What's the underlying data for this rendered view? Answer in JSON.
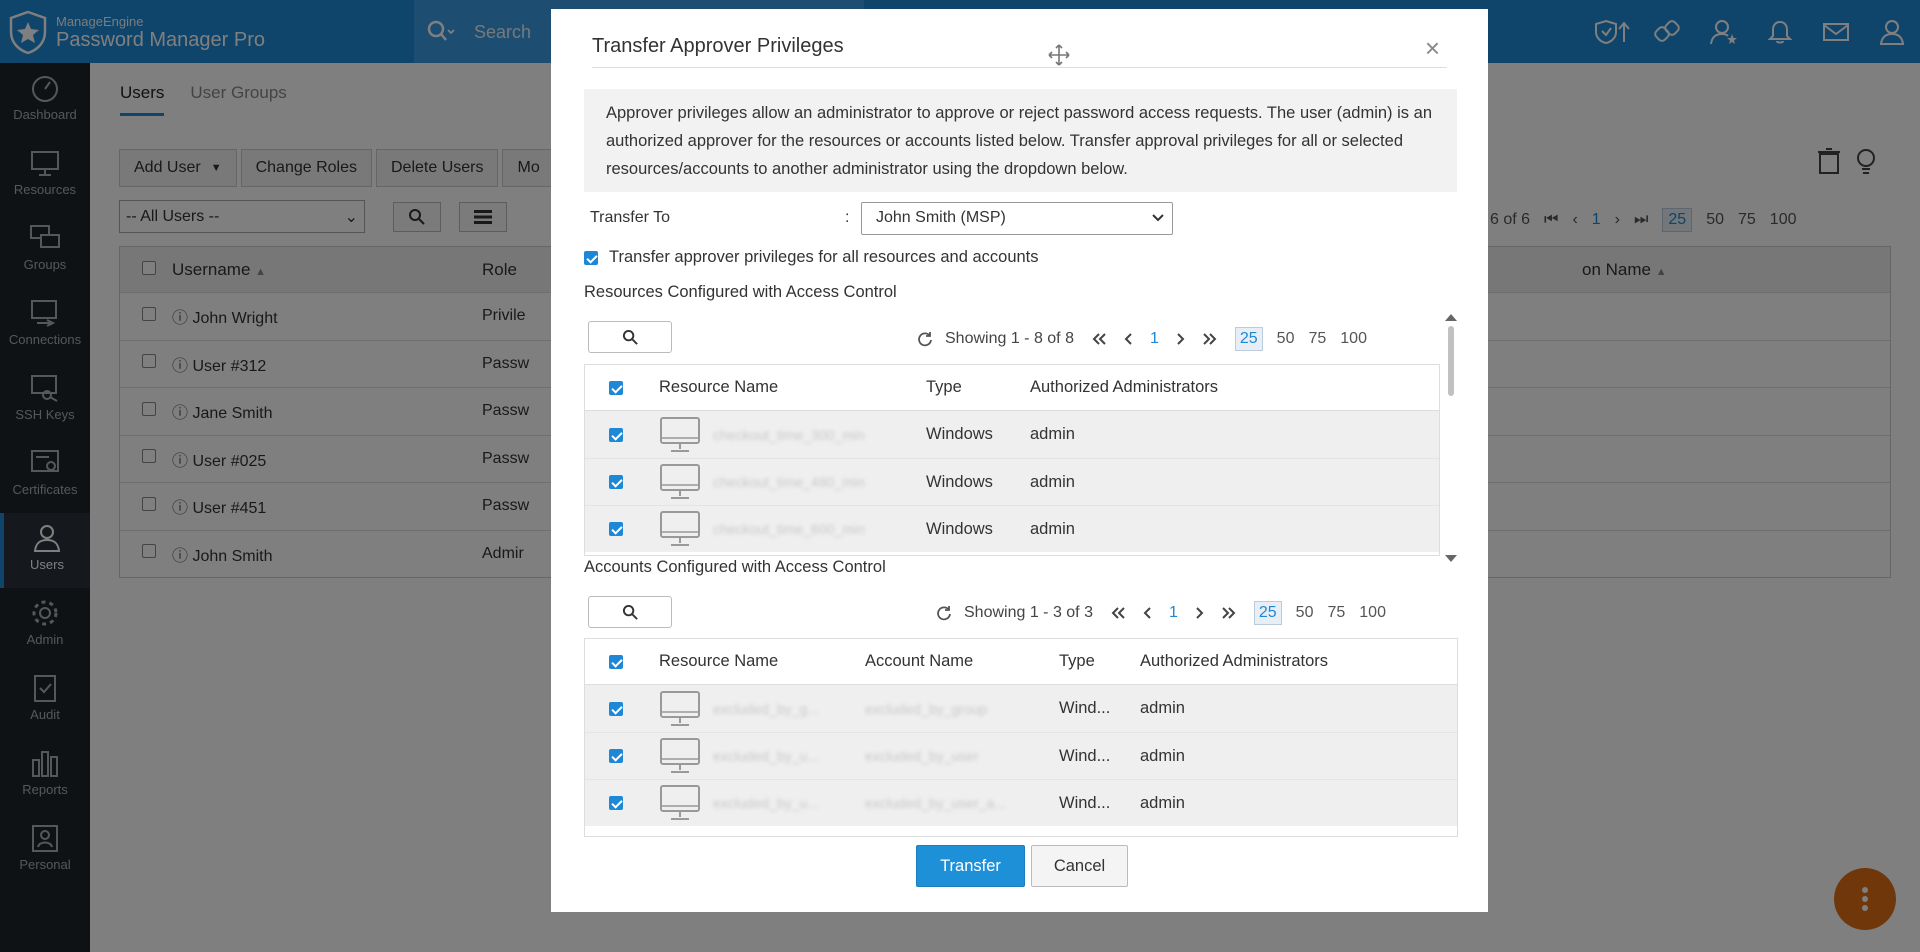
{
  "app": {
    "brand_top": "ManageEngine",
    "brand_bottom": "Password Manager Pro",
    "search_placeholder": "Search"
  },
  "nav": {
    "items": [
      {
        "label": "Dashboard",
        "icon": "dashboard-icon"
      },
      {
        "label": "Resources",
        "icon": "monitor-icon"
      },
      {
        "label": "Groups",
        "icon": "groups-icon"
      },
      {
        "label": "Connections",
        "icon": "connections-icon"
      },
      {
        "label": "SSH Keys",
        "icon": "ssh-keys-icon"
      },
      {
        "label": "Certificates",
        "icon": "certificates-icon"
      },
      {
        "label": "Users",
        "icon": "user-icon",
        "active": true
      },
      {
        "label": "Admin",
        "icon": "gear-icon"
      },
      {
        "label": "Audit",
        "icon": "audit-icon"
      },
      {
        "label": "Reports",
        "icon": "reports-icon"
      },
      {
        "label": "Personal",
        "icon": "personal-icon"
      }
    ]
  },
  "users_page": {
    "tabs": [
      "Users",
      "User Groups"
    ],
    "buttons": {
      "add_user": "Add User",
      "change_roles": "Change Roles",
      "delete_users": "Delete Users",
      "more": "Mo"
    },
    "filter_value": "-- All Users --",
    "columns": {
      "username": "Username",
      "role": "Role",
      "location": "on Name"
    },
    "rows": [
      {
        "username": "John Wright",
        "role": "Privile"
      },
      {
        "username": "User #312",
        "role": "Passw"
      },
      {
        "username": "Jane Smith",
        "role": "Passw"
      },
      {
        "username": "User #025",
        "role": "Passw"
      },
      {
        "username": "User #451",
        "role": "Passw"
      },
      {
        "username": "John Smith",
        "role": "Admir"
      }
    ],
    "pager": {
      "count_text": "6 of 6",
      "page": "1",
      "sizes": [
        "25",
        "50",
        "75",
        "100"
      ]
    }
  },
  "modal": {
    "title": "Transfer Approver Privileges",
    "close": "×",
    "info": "Approver privileges allow an administrator to approve or reject password access requests. The user (admin) is an authorized approver for the resources or accounts listed below. Transfer approval privileges for all or selected resources/accounts to another administrator using the dropdown below.",
    "transfer_to_label": "Transfer To",
    "colon": ":",
    "transfer_to_value": "John Smith (MSP)",
    "all_checkbox_label": "Transfer approver privileges for all resources and accounts",
    "resources": {
      "title": "Resources Configured with Access Control",
      "showing": "Showing 1 - 8 of 8",
      "page": "1",
      "sizes": [
        "25",
        "50",
        "75",
        "100"
      ],
      "columns": {
        "resource": "Resource Name",
        "type": "Type",
        "admins": "Authorized Administrators"
      },
      "rows": [
        {
          "resource": "checkout_time_300_min",
          "type": "Windows",
          "admins": "admin"
        },
        {
          "resource": "checkout_time_480_min",
          "type": "Windows",
          "admins": "admin"
        },
        {
          "resource": "checkout_time_600_min",
          "type": "Windows",
          "admins": "admin"
        }
      ]
    },
    "accounts": {
      "title": "Accounts Configured with Access Control",
      "showing": "Showing 1 - 3 of 3",
      "page": "1",
      "sizes": [
        "25",
        "50",
        "75",
        "100"
      ],
      "columns": {
        "resource": "Resource Name",
        "account": "Account Name",
        "type": "Type",
        "admins": "Authorized Administrators"
      },
      "rows": [
        {
          "resource": "excluded_by_g...",
          "account": "excluded_by_group",
          "type": "Wind...",
          "admins": "admin"
        },
        {
          "resource": "excluded_by_u...",
          "account": "excluded_by_user",
          "type": "Wind...",
          "admins": "admin"
        },
        {
          "resource": "excluded_by_u...",
          "account": "excluded_by_user_a...",
          "type": "Wind...",
          "admins": "admin"
        }
      ]
    },
    "transfer_button": "Transfer",
    "cancel_button": "Cancel"
  },
  "colors": {
    "primary": "#1e88d6",
    "nav_bg": "#1f2429",
    "fab": "#e06f16"
  }
}
